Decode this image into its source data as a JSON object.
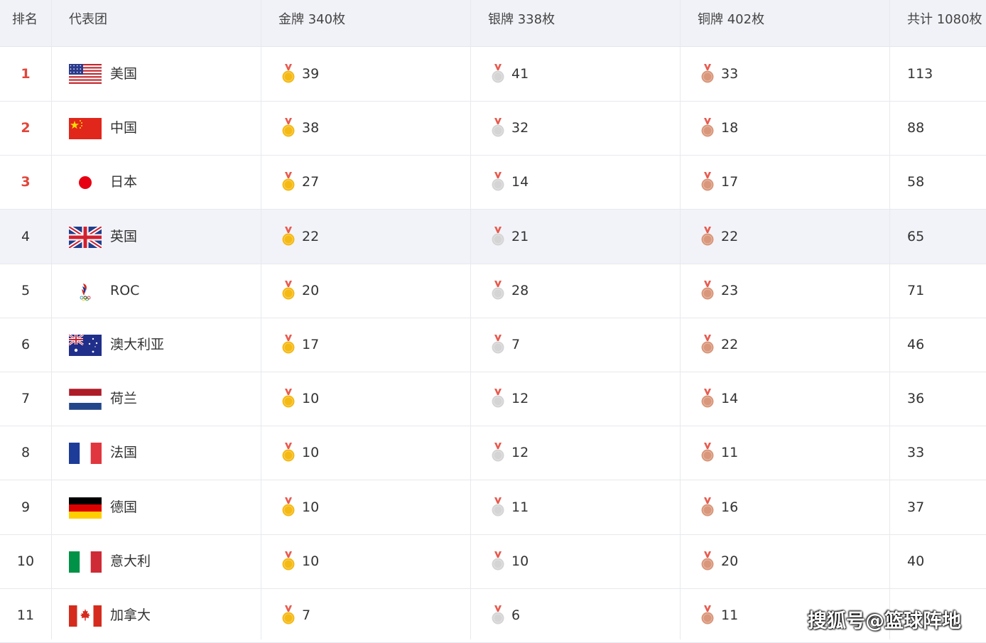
{
  "header": {
    "rank": "排名",
    "team": "代表团",
    "gold": "金牌 340枚",
    "silver": "银牌 338枚",
    "bronze": "铜牌 402枚",
    "total": "共计 1080枚"
  },
  "rows": [
    {
      "rank": "1",
      "name": "美国",
      "flag": "usa-flag",
      "gold": "39",
      "silver": "41",
      "bronze": "33",
      "total": "113"
    },
    {
      "rank": "2",
      "name": "中国",
      "flag": "china-flag",
      "gold": "38",
      "silver": "32",
      "bronze": "18",
      "total": "88"
    },
    {
      "rank": "3",
      "name": "日本",
      "flag": "japan-flag",
      "gold": "27",
      "silver": "14",
      "bronze": "17",
      "total": "58"
    },
    {
      "rank": "4",
      "name": "英国",
      "flag": "uk-flag",
      "gold": "22",
      "silver": "21",
      "bronze": "22",
      "total": "65"
    },
    {
      "rank": "5",
      "name": "ROC",
      "flag": "roc-emblem",
      "gold": "20",
      "silver": "28",
      "bronze": "23",
      "total": "71"
    },
    {
      "rank": "6",
      "name": "澳大利亚",
      "flag": "australia-flag",
      "gold": "17",
      "silver": "7",
      "bronze": "22",
      "total": "46"
    },
    {
      "rank": "7",
      "name": "荷兰",
      "flag": "netherlands-flag",
      "gold": "10",
      "silver": "12",
      "bronze": "14",
      "total": "36"
    },
    {
      "rank": "8",
      "name": "法国",
      "flag": "france-flag",
      "gold": "10",
      "silver": "12",
      "bronze": "11",
      "total": "33"
    },
    {
      "rank": "9",
      "name": "德国",
      "flag": "germany-flag",
      "gold": "10",
      "silver": "11",
      "bronze": "16",
      "total": "37"
    },
    {
      "rank": "10",
      "name": "意大利",
      "flag": "italy-flag",
      "gold": "10",
      "silver": "10",
      "bronze": "20",
      "total": "40"
    },
    {
      "rank": "11",
      "name": "加拿大",
      "flag": "canada-flag",
      "gold": "7",
      "silver": "6",
      "bronze": "11",
      "total": ""
    }
  ],
  "watermark": "搜狐号@篮球阵地",
  "colors": {
    "top_rank": "#e1463b",
    "gold": "#f5b914",
    "silver": "#d4d4d4",
    "bronze": "#d9967a",
    "header_bg": "#f1f2f7",
    "highlight_row": "#f2f3f8"
  }
}
